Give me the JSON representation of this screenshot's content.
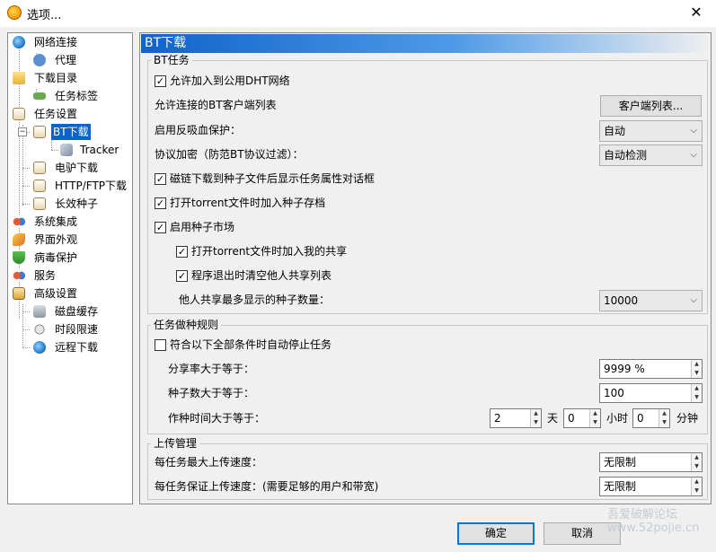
{
  "window": {
    "title": "选项...",
    "close_glyph": "✕"
  },
  "tree": {
    "items": [
      {
        "label": "网络连接",
        "icon": "globe-icon"
      },
      {
        "label": "代理",
        "icon": "proxy-icon"
      },
      {
        "label": "下载目录",
        "icon": "folder-icon"
      },
      {
        "label": "任务标签",
        "icon": "tag-icon"
      },
      {
        "label": "任务设置",
        "icon": "task-icon"
      },
      {
        "label": "BT下载",
        "icon": "bt-icon",
        "selected": true
      },
      {
        "label": "Tracker",
        "icon": "tracker-icon"
      },
      {
        "label": "电驴下载",
        "icon": "emule-icon"
      },
      {
        "label": "HTTP/FTP下载",
        "icon": "http-icon"
      },
      {
        "label": "长效种子",
        "icon": "seed-icon"
      },
      {
        "label": "系统集成",
        "icon": "integration-icon"
      },
      {
        "label": "界面外观",
        "icon": "appearance-icon"
      },
      {
        "label": "病毒保护",
        "icon": "shield-icon"
      },
      {
        "label": "服务",
        "icon": "service-icon"
      },
      {
        "label": "高级设置",
        "icon": "advanced-icon"
      },
      {
        "label": "磁盘缓存",
        "icon": "disk-icon"
      },
      {
        "label": "时段限速",
        "icon": "speed-icon"
      },
      {
        "label": "远程下载",
        "icon": "remote-icon"
      }
    ]
  },
  "panel": {
    "header": "BT下载",
    "bt_group": {
      "title": "BT任务",
      "allow_dht": {
        "label": "允许加入到公用DHT网络",
        "checked": true
      },
      "client_list_label": "允许连接的BT客户端列表",
      "client_list_button": "客户端列表...",
      "anti_leech_label": "启用反吸血保护：",
      "anti_leech_value": "自动",
      "encryption_label": "协议加密（防范BT协议过滤）：",
      "encryption_value": "自动检测",
      "magnet_props": {
        "label": "磁链下载到种子文件后显示任务属性对话框",
        "checked": true
      },
      "open_torrent_archive": {
        "label": "打开torrent文件时加入种子存档",
        "checked": true
      },
      "seed_market": {
        "label": "启用种子市场",
        "checked": true
      },
      "add_to_share": {
        "label": "打开torrent文件时加入我的共享",
        "checked": true
      },
      "clear_share_on_exit": {
        "label": "程序退出时清空他人共享列表",
        "checked": true
      },
      "max_seeds_label": "他人共享最多显示的种子数量：",
      "max_seeds_value": "10000"
    },
    "seeding_group": {
      "title": "任务做种规则",
      "auto_stop": {
        "label": "符合以下全部条件时自动停止任务",
        "checked": false
      },
      "ratio_label": "分享率大于等于：",
      "ratio_value": "9999 %",
      "seeds_label": "种子数大于等于：",
      "seeds_value": "100",
      "time_label": "作种时间大于等于：",
      "days_value": "2",
      "days_unit": "天",
      "hours_value": "0",
      "hours_unit": "小时",
      "minutes_value": "0",
      "minutes_unit": "分钟"
    },
    "upload_group": {
      "title": "上传管理",
      "max_upload_label": "每任务最大上传速度：",
      "max_upload_value": "无限制",
      "guarantee_upload_label": "每任务保证上传速度：(需要足够的用户和带宽)",
      "guarantee_upload_value": "无限制"
    }
  },
  "footer": {
    "ok": "确定",
    "cancel": "取消"
  },
  "watermark": {
    "line1": "吾爱破解论坛",
    "line2": "www.52pojie.cn"
  },
  "glyphs": {
    "check": "✓",
    "arrow_down": "⌵",
    "spin_up": "▲",
    "spin_down": "▼",
    "minus": "−",
    "plus": "+"
  },
  "colors": {
    "selection": "#0a63c8",
    "header_start": "#0f63c9",
    "header_end": "#4e9ae8"
  }
}
